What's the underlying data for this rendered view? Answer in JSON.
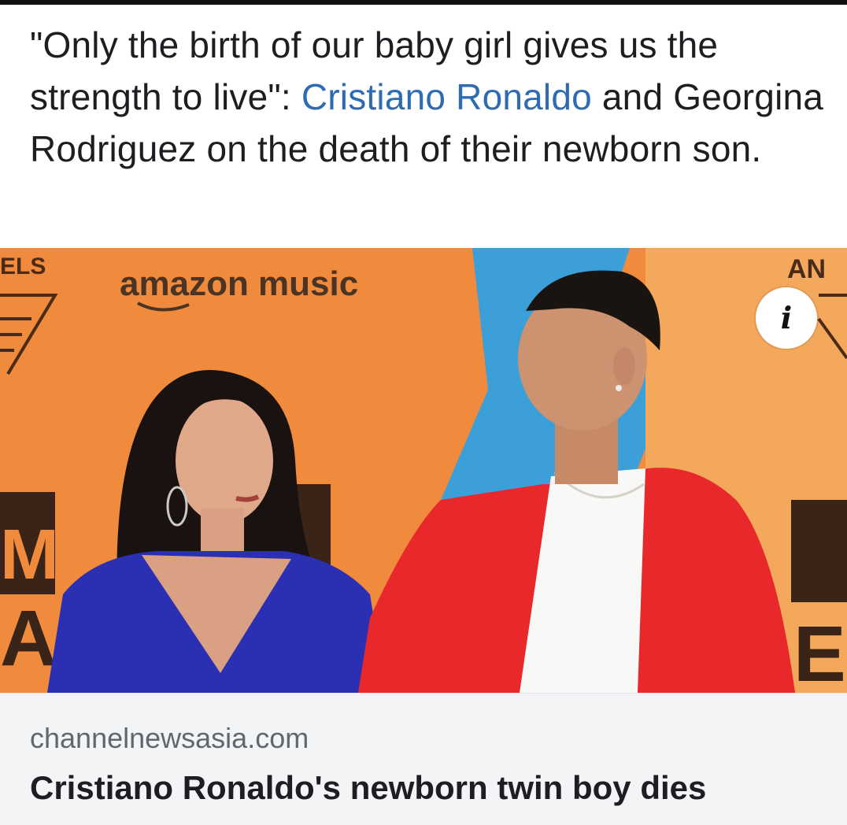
{
  "post": {
    "text_before": "\"Only the birth of our baby girl gives us the strength to live\": ",
    "mention": "Cristiano Ronaldo",
    "text_after": " and Georgina Rodriguez on the death of their newborn son."
  },
  "media": {
    "brand_logo": "amazon music",
    "backdrop_letters": {
      "left_top": "ELS",
      "left_mid": "M",
      "left_bottom": "A",
      "right_top": "AN",
      "right_bottom": "E"
    },
    "info_icon": "i",
    "colors": {
      "backdrop_orange": "#f08a3c",
      "backdrop_blue": "#3c9fd8",
      "jacket_red": "#e8282a",
      "dress_blue": "#2b2fb2"
    }
  },
  "link": {
    "domain": "channelnewsasia.com",
    "headline": "Cristiano Ronaldo's newborn twin boy dies"
  }
}
